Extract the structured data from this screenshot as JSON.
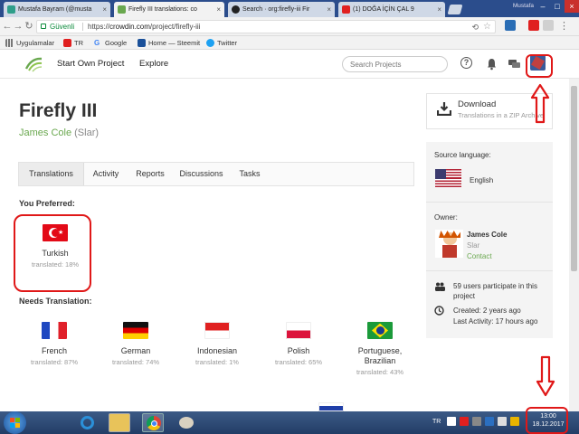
{
  "browser": {
    "tabs": [
      {
        "title": "Mustafa Bayram (@musta",
        "color": "#2e9e8a"
      },
      {
        "title": "Firefly III translations: co",
        "color": "#6aa84f"
      },
      {
        "title": "Search · org:firefly-iii Fir",
        "color": "#222222"
      },
      {
        "title": "(1) DOĞA İÇİN ÇAL 9",
        "color": "#e02020"
      }
    ],
    "window_user": "Mustafa",
    "secure_label": "Güvenli",
    "url_prefix": "https://",
    "url_host": "crowdin.com",
    "url_path": "/project/firefly-iii",
    "bookmarks": [
      {
        "label": "Uygulamalar",
        "color": "#888888"
      },
      {
        "label": "TR",
        "color": "#e02020"
      },
      {
        "label": "Google",
        "color": "#4285f4"
      },
      {
        "label": "Home — Steemit",
        "color": "#1a5099"
      },
      {
        "label": "Twitter",
        "color": "#1da1f2"
      }
    ]
  },
  "header": {
    "nav": [
      "Start Own Project",
      "Explore"
    ],
    "search_placeholder": "Search Projects"
  },
  "project": {
    "title": "Firefly III",
    "owner_name": "James Cole",
    "owner_handle": "(Slar)",
    "tabs": [
      "Translations",
      "Activity",
      "Reports",
      "Discussions",
      "Tasks"
    ],
    "active_tab": "Translations"
  },
  "preferred": {
    "heading": "You Preferred:",
    "language": {
      "name": "Turkish",
      "status": "translated: 18%"
    }
  },
  "needs": {
    "heading": "Needs Translation:",
    "languages": [
      {
        "name": "French",
        "status": "translated: 87%"
      },
      {
        "name": "German",
        "status": "translated: 74%"
      },
      {
        "name": "Indonesian",
        "status": "translated: 1%"
      },
      {
        "name": "Polish",
        "status": "translated: 65%"
      },
      {
        "name": "Portuguese, Brazilian",
        "name_line1": "Portuguese,",
        "name_line2": "Brazilian",
        "status": "translated: 43%"
      }
    ]
  },
  "sidebar": {
    "download_title": "Download",
    "download_sub": "Translations in a ZIP Archive",
    "source_heading": "Source language:",
    "source_language": "English",
    "owner_heading": "Owner:",
    "owner_name": "James Cole",
    "owner_handle": "Slar",
    "contact_label": "Contact",
    "participants": "59 users participate in this project",
    "created": "Created: 2 years ago",
    "last_activity": "Last Activity: 17 hours ago"
  },
  "taskbar": {
    "language": "TR",
    "time": "13:00",
    "date": "18.12.2017"
  },
  "colors": {
    "accent_green": "#6aa84f",
    "annotation_red": "#e01818",
    "taskbar": "#2b4d7c"
  }
}
